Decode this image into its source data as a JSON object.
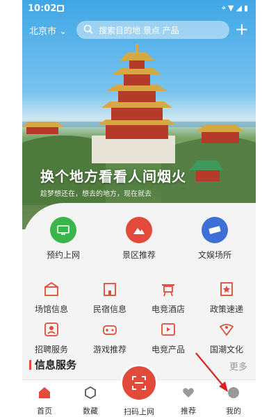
{
  "status": {
    "time": "10:02"
  },
  "header": {
    "city": "北京市",
    "search_placeholder": "搜索目的地 景点 产品",
    "add_label": "+"
  },
  "hero": {
    "title": "换个地方看看人间烟火",
    "subtitle": "趁梦想还在，想去的地方，现在就去"
  },
  "primary": [
    {
      "label": "预约上网",
      "color": "#3ab54a",
      "icon": "monitor-icon"
    },
    {
      "label": "景区推荐",
      "color": "#e24a3b",
      "icon": "mountain-icon"
    },
    {
      "label": "文娱场所",
      "color": "#3d6fd6",
      "icon": "ticket-icon"
    }
  ],
  "grid": [
    {
      "label": "场馆信息",
      "icon": "venue-icon"
    },
    {
      "label": "民宿信息",
      "icon": "homestay-icon"
    },
    {
      "label": "电竞酒店",
      "icon": "esports-hotel-icon"
    },
    {
      "label": "政策速递",
      "icon": "policy-icon"
    },
    {
      "label": "招聘服务",
      "icon": "recruit-icon"
    },
    {
      "label": "游戏推荐",
      "icon": "gamepad-icon"
    },
    {
      "label": "电竞产品",
      "icon": "video-product-icon"
    },
    {
      "label": "国潮文化",
      "icon": "culture-icon"
    }
  ],
  "info": {
    "title": "信息服务",
    "more": "更多"
  },
  "tabs": [
    {
      "label": "首页",
      "icon": "home-icon"
    },
    {
      "label": "数藏",
      "icon": "collection-icon"
    },
    {
      "label": "扫码上网",
      "icon": "scan-icon"
    },
    {
      "label": "推荐",
      "icon": "heart-icon"
    },
    {
      "label": "我的",
      "icon": "profile-icon"
    }
  ],
  "colors": {
    "accent": "#e24a3b",
    "text": "#333333"
  }
}
